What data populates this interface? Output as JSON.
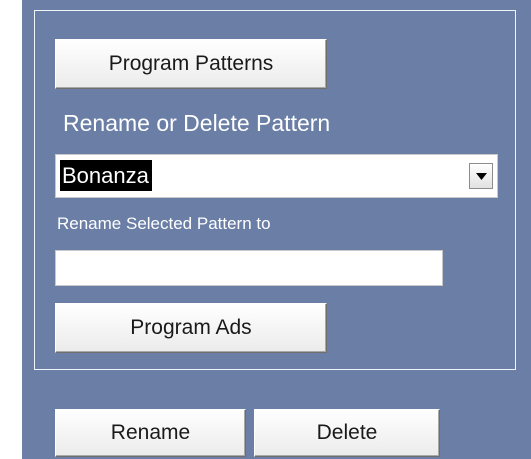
{
  "buttons": {
    "program_patterns": "Program Patterns",
    "program_ads": "Program Ads",
    "rename": "Rename",
    "delete": "Delete"
  },
  "rename_delete": {
    "heading": "Rename or Delete Pattern",
    "selected_pattern": "Bonanza",
    "rename_label": "Rename Selected Pattern to",
    "rename_value": ""
  },
  "icons": {
    "dropdown": "triangle-down-icon"
  },
  "colors": {
    "form_background": "#6a7ea6",
    "selection_highlight": "#000000"
  }
}
